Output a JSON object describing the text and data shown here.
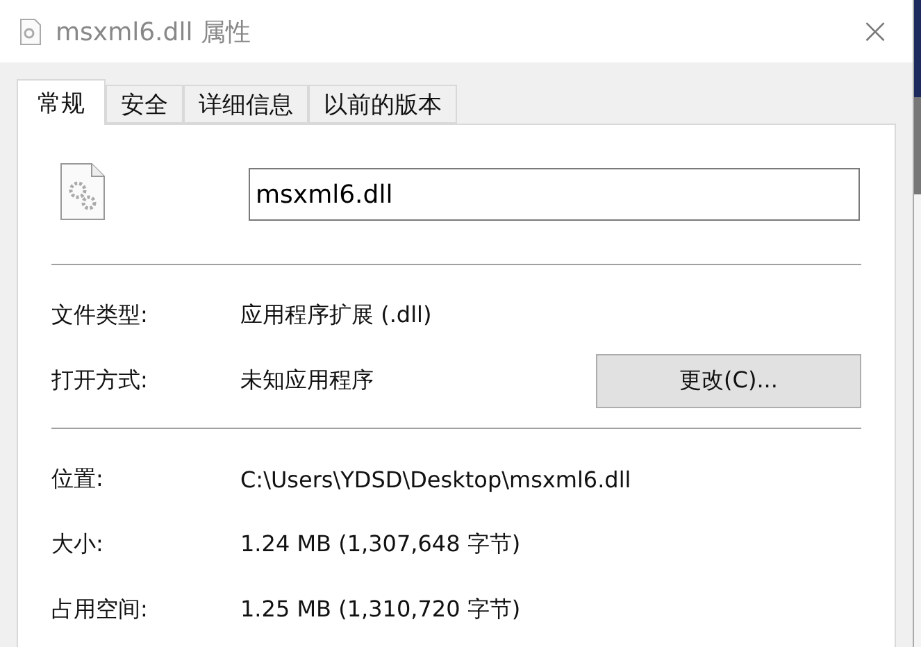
{
  "window": {
    "title": "msxml6.dll 属性",
    "close": "×"
  },
  "tabs": [
    {
      "label": "常规",
      "selected": true
    },
    {
      "label": "安全",
      "selected": false
    },
    {
      "label": "详细信息",
      "selected": false
    },
    {
      "label": "以前的版本",
      "selected": false
    }
  ],
  "file_name": "msxml6.dll",
  "groups": [
    [
      {
        "label": "文件类型:",
        "value": "应用程序扩展 (.dll)"
      },
      {
        "label": "打开方式:",
        "value": "未知应用程序",
        "button": "更改(C)..."
      }
    ],
    [
      {
        "label": "位置:",
        "value": "C:\\Users\\YDSD\\Desktop\\msxml6.dll"
      },
      {
        "label": "大小:",
        "value": "1.24 MB (1,307,648 字节)"
      },
      {
        "label": "占用空间:",
        "value": "1.25 MB (1,310,720 字节)"
      }
    ]
  ]
}
